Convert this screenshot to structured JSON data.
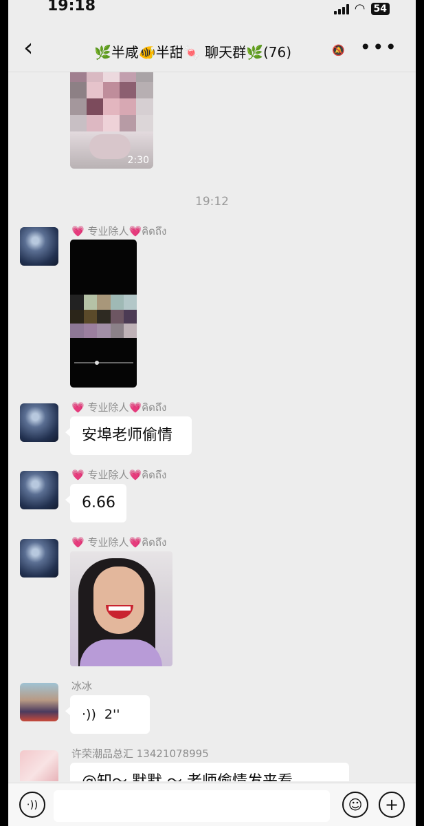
{
  "status_bar": {
    "time": "19:18",
    "battery": "54"
  },
  "header": {
    "back_icon": "back-chevron-icon",
    "title": "🌿半咸🐠半甜🍬 聊天群🌿(76)",
    "more_icon": "more-dots-icon",
    "muted": true
  },
  "chat": {
    "timestamp": "19:12",
    "video_duration": "2:30",
    "messages": [
      {
        "sender": "💗 专业除人💗คิดถึง",
        "type": "video"
      },
      {
        "sender": "💗 专业除人💗คิดถึง",
        "type": "text",
        "text": "安埠老师偷情"
      },
      {
        "sender": "💗 专业除人💗คิดถึง",
        "type": "text",
        "text": "6.66"
      },
      {
        "sender": "💗 专业除人💗คิดถึง",
        "type": "image"
      },
      {
        "sender": "冰冰",
        "type": "voice",
        "text": "2''"
      },
      {
        "sender": "许荣潮品总汇 13421078995",
        "type": "text",
        "text": "@知～ 默默 ～ 老师偷情发来看"
      }
    ]
  },
  "bottom_bar": {
    "voice_icon": "voice-input-icon",
    "emoji_icon": "emoji-icon",
    "plus_icon": "plus-icon"
  }
}
